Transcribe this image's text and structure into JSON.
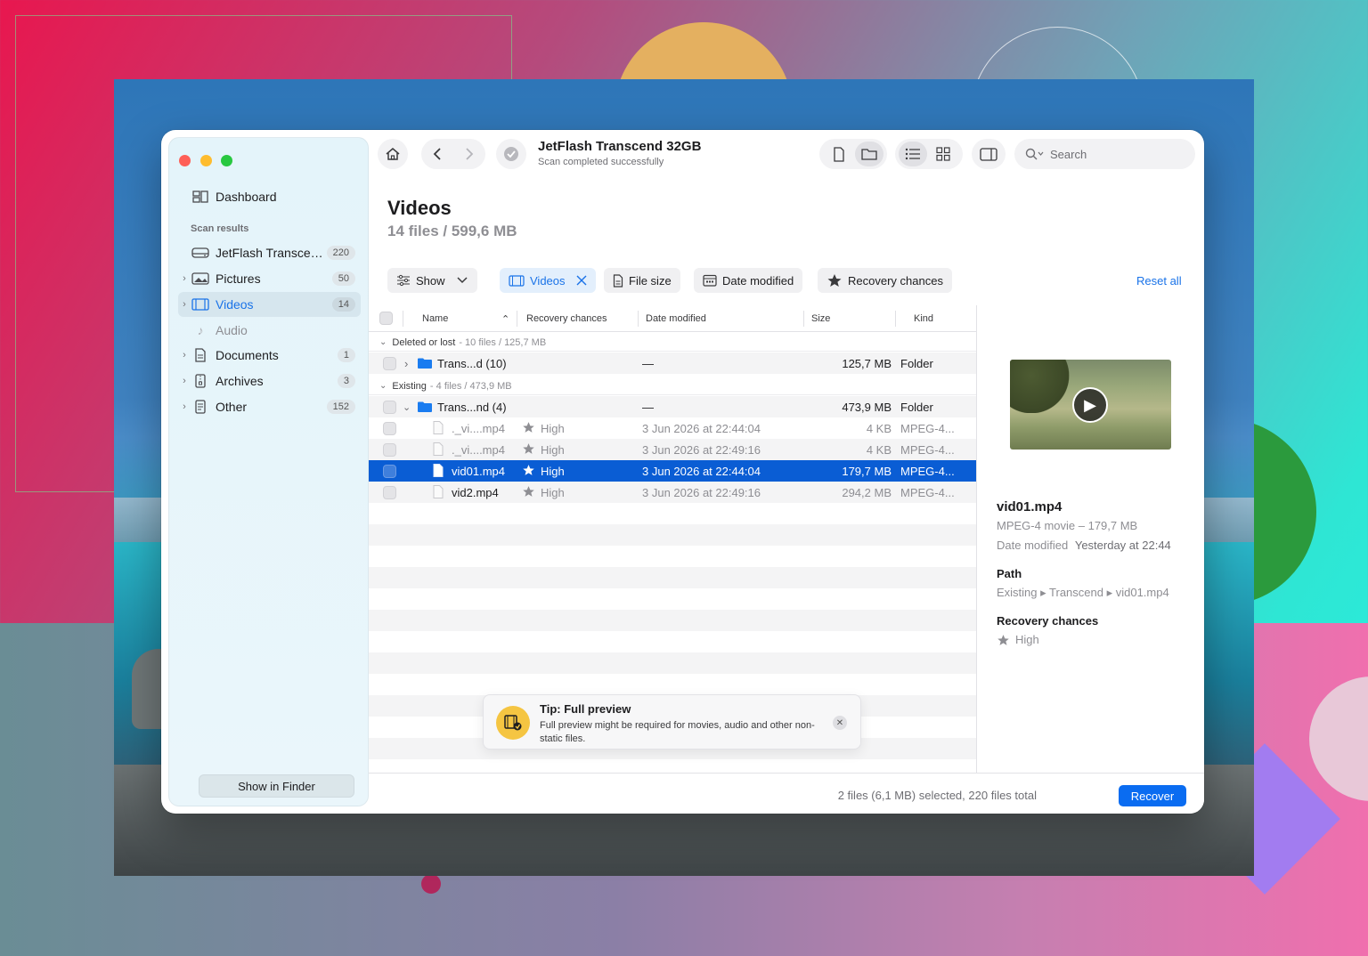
{
  "window": {
    "title": "JetFlash Transcend 32GB",
    "subtitle": "Scan completed successfully"
  },
  "search": {
    "placeholder": "Search"
  },
  "sidebar": {
    "dashboard_label": "Dashboard",
    "section_label": "Scan results",
    "items": [
      {
        "label": "JetFlash Transcend 32GB",
        "count": "220"
      },
      {
        "label": "Pictures",
        "count": "50"
      },
      {
        "label": "Videos",
        "count": "14"
      },
      {
        "label": "Audio",
        "count": ""
      },
      {
        "label": "Documents",
        "count": "1"
      },
      {
        "label": "Archives",
        "count": "3"
      },
      {
        "label": "Other",
        "count": "152"
      }
    ],
    "show_in_finder": "Show in Finder"
  },
  "main": {
    "title": "Videos",
    "subtitle": "14 files / 599,6 MB"
  },
  "filters": {
    "show": "Show",
    "videos": "Videos",
    "file_size": "File size",
    "date_modified": "Date modified",
    "recovery_chances": "Recovery chances",
    "reset_all": "Reset all"
  },
  "table": {
    "columns": [
      "Name",
      "Recovery chances",
      "Date modified",
      "Size",
      "Kind"
    ],
    "groups": [
      {
        "label": "Deleted or lost",
        "meta": "- 10 files / 125,7 MB"
      },
      {
        "label": "Existing",
        "meta": "- 4 files / 473,9 MB"
      }
    ],
    "rows": [
      {
        "name": "Trans...d (10)",
        "chances": "",
        "date": "—",
        "size": "125,7 MB",
        "kind": "Folder"
      },
      {
        "name": "Trans...nd (4)",
        "chances": "",
        "date": "—",
        "size": "473,9 MB",
        "kind": "Folder"
      },
      {
        "name": "._vi....mp4",
        "chances": "High",
        "date": "3 Jun 2026 at 22:44:04",
        "size": "4 KB",
        "kind": "MPEG-4..."
      },
      {
        "name": "._vi....mp4",
        "chances": "High",
        "date": "3 Jun 2026 at 22:49:16",
        "size": "4 KB",
        "kind": "MPEG-4..."
      },
      {
        "name": "vid01.mp4",
        "chances": "High",
        "date": "3 Jun 2026 at 22:44:04",
        "size": "179,7 MB",
        "kind": "MPEG-4..."
      },
      {
        "name": "vid2.mp4",
        "chances": "High",
        "date": "3 Jun 2026 at 22:49:16",
        "size": "294,2 MB",
        "kind": "MPEG-4..."
      }
    ]
  },
  "preview": {
    "name": "vid01.mp4",
    "type_size": "MPEG-4 movie – 179,7 MB",
    "date_label": "Date modified",
    "date_value": "Yesterday at 22:44",
    "path_label": "Path",
    "path_value": "Existing ▸ Transcend ▸ vid01.mp4",
    "chances_label": "Recovery chances",
    "chances_value": "High"
  },
  "tip": {
    "title": "Tip: Full preview",
    "body": "Full preview might be required for movies, audio and other non-static files."
  },
  "footer": {
    "status": "2 files (6,1 MB) selected, 220 files total",
    "recover": "Recover"
  },
  "colors": {
    "accent": "#0a6cf1",
    "selection": "#0a5dd4",
    "tip_icon": "#f5c542"
  }
}
